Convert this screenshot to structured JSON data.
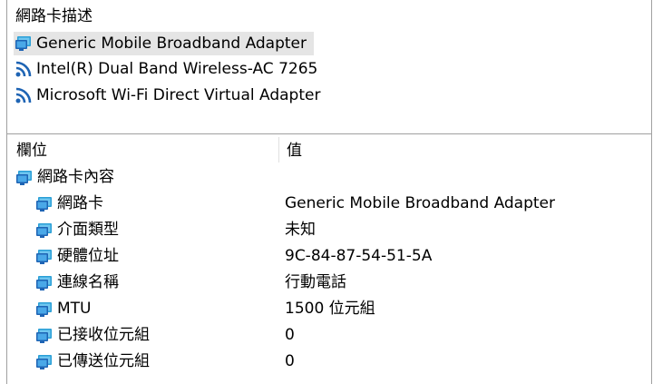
{
  "adapter_pane": {
    "title": "網路卡描述",
    "adapters": [
      {
        "label": "Generic Mobile Broadband Adapter",
        "icon": "network-adapter-icon",
        "selected": true
      },
      {
        "label": "Intel(R) Dual Band Wireless-AC 7265",
        "icon": "wifi-signal-icon",
        "selected": false
      },
      {
        "label": "Microsoft Wi-Fi Direct Virtual Adapter",
        "icon": "wifi-signal-icon",
        "selected": false
      }
    ]
  },
  "details": {
    "columns": {
      "field": "欄位",
      "value": "值"
    },
    "group": {
      "label": "網路卡內容",
      "icon": "network-adapter-icon"
    },
    "rows": [
      {
        "field": "網路卡",
        "value": "Generic Mobile Broadband Adapter"
      },
      {
        "field": "介面類型",
        "value": "未知"
      },
      {
        "field": "硬體位址",
        "value": "9C-84-87-54-51-5A"
      },
      {
        "field": "連線名稱",
        "value": "行動電話"
      },
      {
        "field": "MTU",
        "value": "1500 位元組"
      },
      {
        "field": "已接收位元組",
        "value": "0"
      },
      {
        "field": "已傳送位元組",
        "value": "0"
      }
    ]
  },
  "colors": {
    "selection": "#e5e5e5",
    "border": "#a0a0a0",
    "icon_blue": "#1e64b4",
    "icon_teal": "#2a9fd6"
  }
}
